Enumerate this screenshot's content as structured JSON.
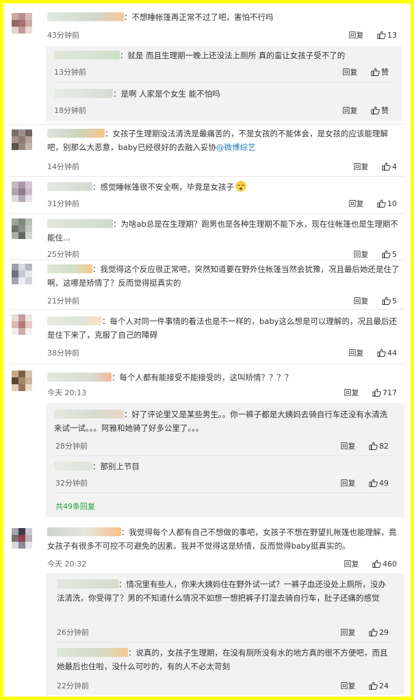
{
  "reply_label": "回复",
  "like_placeholder": "赞",
  "comments": [
    {
      "text": "：不想睡帐篷再正常不过了吧，害怕不行吗",
      "time": "43分钟前",
      "likes": "13"
    },
    {
      "text": "：女孩子生理期没法清洗是最痛苦的，不是女孩的不能体会，是女孩的应该能理解吧，别那么大恶意，baby已经很好的去融入妥协",
      "tag": "@微博综艺",
      "time": "14分钟前",
      "likes": "4"
    },
    {
      "text": "：感觉睡帐篷很不安全啊，毕竟是女孩子",
      "time": "31分钟前",
      "likes": "10"
    },
    {
      "text": "：为啥ab总是在生理期？跑男也是各种生理期不能下水，现在住帐篷也是生理期不能住...",
      "time": "25分钟前",
      "likes": "5"
    },
    {
      "text": "：我觉得这个反应很正常吧，突然知道要在野外住帐篷当然会犹豫，况且最后她还是住了啊，这哪是矫情了？反而觉得挺真实的",
      "time": "21分钟前",
      "likes": "5"
    },
    {
      "text": "：每个人对同一件事情的看法也是不一样的，baby这么想是可以理解的，况且最后还是住下来了，克服了自己的障碍",
      "time": "38分钟前",
      "likes": "44"
    },
    {
      "text": "：每个人都有能接受不能接受的，这叫矫情？？？？",
      "time": "今天 20:13",
      "likes": "717"
    },
    {
      "text": "：我觉得每个人都有自己不想做的事吧，女孩子不想在野望扎帐篷也能理解，竟女孩子有很多不可控不可避免的因素。我并不觉得这是矫情，反而觉得baby挺真实的。",
      "time": "今天 20:32",
      "likes": "460"
    }
  ],
  "replies": [
    {
      "text": "：就是 而且生理期一晚上还没法上厕所 真的蛮让女孩子受不了的",
      "time": "13分钟前",
      "likes": "赞"
    },
    {
      "text": "：是啊 人家是个女生 能不怕吗",
      "time": "18分钟前",
      "likes": "赞"
    },
    {
      "text": "：好了评论里又是某些男生。。你一裤子都是大姨妈去骑自行车还没有水清洗来试一试。。。阿雅和她骑了好多公里了。。。",
      "time": "28分钟前",
      "likes": "82"
    },
    {
      "text": "：那别上节目",
      "time": "32分钟前",
      "likes": "49"
    },
    {
      "text": "：情况里有些人，你来大姨妈住在野外试一试？一裤子血还没处上厕所，没办法清洗，你受得了？男的不知道什么情况不如想一想把裤子打湿去骑自行车，肚子还痛的感觉",
      "time": "26分钟前",
      "likes": "29"
    },
    {
      "text": "：说真的，女孩子生理期，在没有厕所没有水的地方真的很不方便吧，而且她最后也住啦，没什么可吵的，有的人不必太苛刻",
      "time": "22分钟前",
      "likes": "24"
    }
  ],
  "more_replies": "共49条回复",
  "colors": {
    "frame": "#ffff00",
    "link": "#1e9e3a",
    "tag": "#2a7ac0",
    "reply_bg": "#f2f2f2"
  },
  "icons": {
    "like": "thumb-up-icon",
    "emoji": "sleepy-face-icon"
  }
}
